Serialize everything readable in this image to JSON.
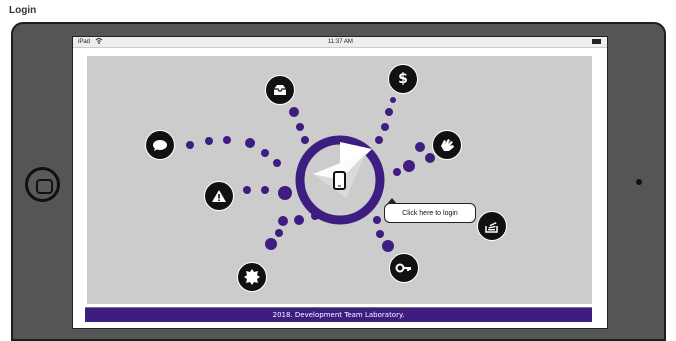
{
  "page": {
    "title": "Login"
  },
  "device": {
    "status_device": "iPad",
    "status_time": "11:37 AM"
  },
  "hub": {
    "center_icon": "mobile-phone-icon",
    "ring_color": "#3d1d7f",
    "dot_color": "#3d1d7f"
  },
  "menu_icons": [
    {
      "name": "inbox-icon",
      "glyph": "⛀"
    },
    {
      "name": "dollar-icon",
      "glyph": "$"
    },
    {
      "name": "chat-bubble-icon",
      "glyph": "💬"
    },
    {
      "name": "hand-icon",
      "glyph": "✋"
    },
    {
      "name": "warning-icon",
      "glyph": "⚠"
    },
    {
      "name": "stack-overflow-icon",
      "glyph": "≣"
    },
    {
      "name": "certificate-badge-icon",
      "glyph": "✹"
    },
    {
      "name": "key-icon",
      "glyph": "⚷"
    }
  ],
  "login": {
    "label": "Click here to login"
  },
  "footer": {
    "text": "2018. Development Team Laboratory."
  },
  "colors": {
    "accent": "#3d1d7f",
    "canvas": "#cccccc",
    "frame": "#555555"
  }
}
